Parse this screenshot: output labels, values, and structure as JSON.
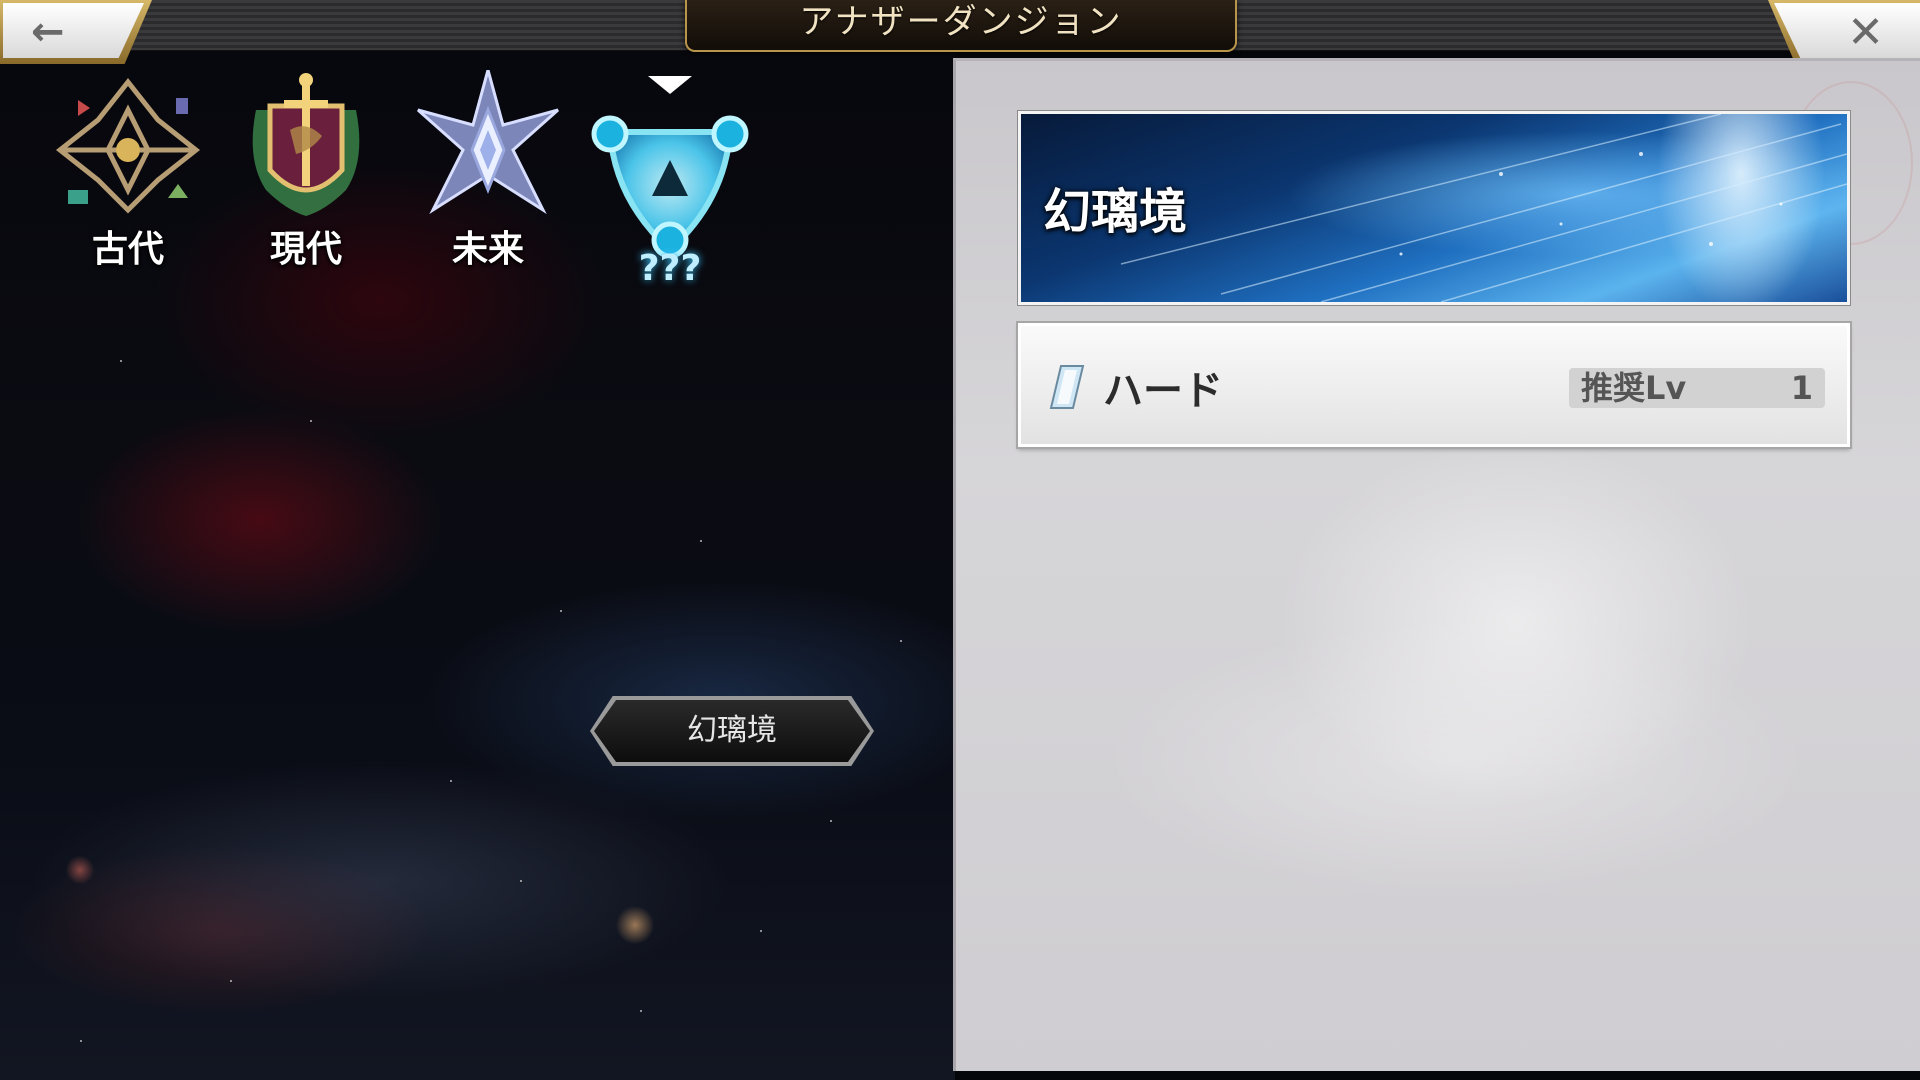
{
  "header": {
    "title": "アナザーダンジョン",
    "back_icon": "arrow-left",
    "close_icon": "close-x"
  },
  "eras": [
    {
      "label": "古代",
      "icon": "ancient-emblem-icon"
    },
    {
      "label": "現代",
      "icon": "modern-crest-icon"
    },
    {
      "label": "未来",
      "icon": "future-star-icon"
    },
    {
      "label": "???",
      "icon": "mystery-triangle-icon",
      "selected": true
    }
  ],
  "map": {
    "location_label": "幻璃境"
  },
  "panel": {
    "banner_title": "幻璃境",
    "quest": {
      "name": "ハード",
      "recommended_label": "推奨Lv",
      "recommended_value": "1"
    }
  },
  "colors": {
    "gold_frame": "#b8954a",
    "selected_glow": "#5fd8ff",
    "panel_bg": "#d0cfd2"
  }
}
